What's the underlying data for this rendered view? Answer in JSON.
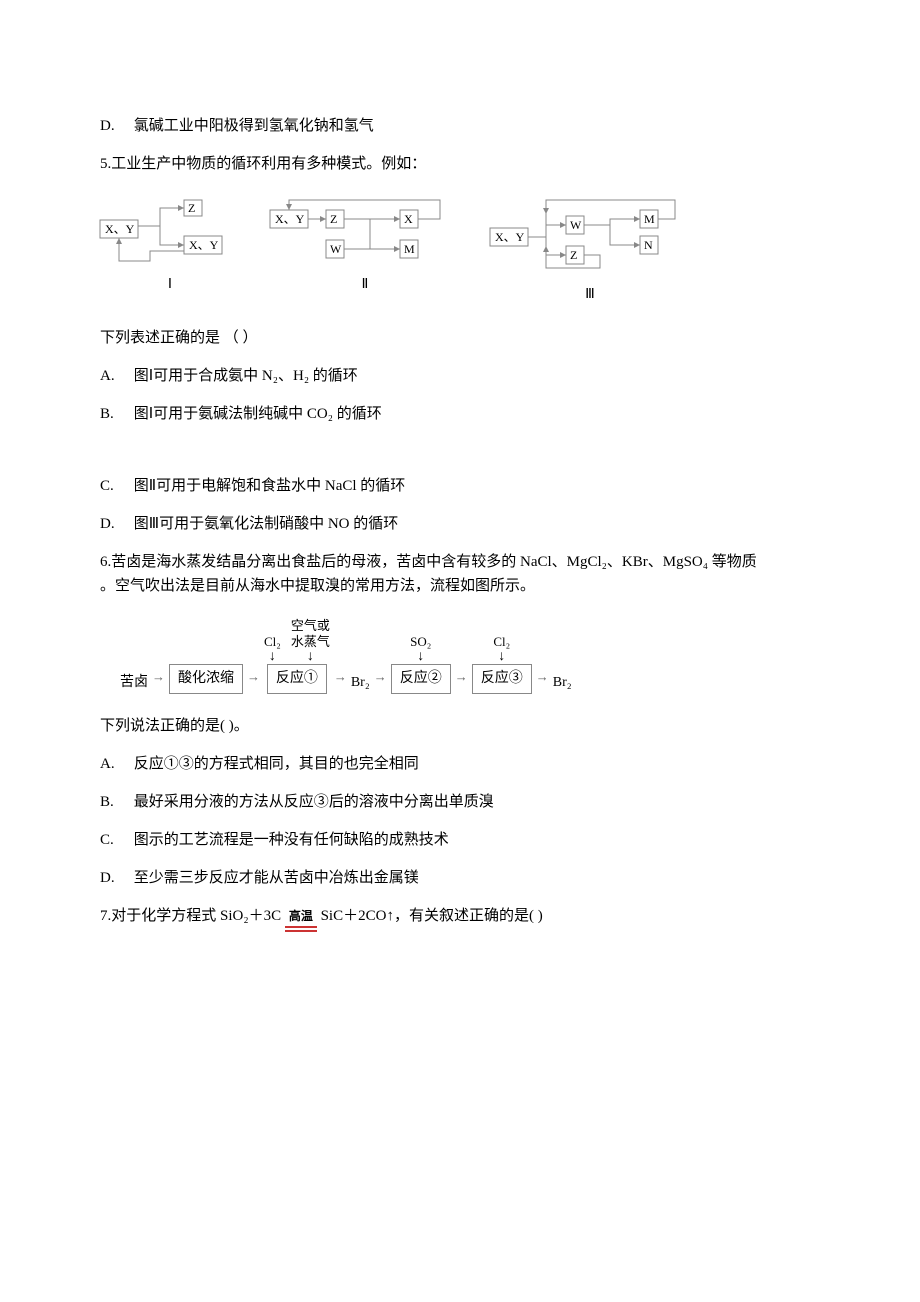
{
  "q4": {
    "d": "氯碱工业中阳极得到氢氧化钠和氢气"
  },
  "q5": {
    "stem": "5.工业生产中物质的循环利用有多种模式。例如：",
    "diagram": {
      "groups": [
        {
          "label": "Ⅰ",
          "boxes": {
            "xy": "X、Y",
            "z": "Z",
            "xy2": "X、Y"
          }
        },
        {
          "label": "Ⅱ",
          "boxes": {
            "xy": "X、Y",
            "z": "Z",
            "w": "W",
            "x": "X",
            "m": "M"
          }
        },
        {
          "label": "Ⅲ",
          "boxes": {
            "xy": "X、Y",
            "w": "W",
            "z": "Z",
            "m": "M",
            "n": "N"
          }
        }
      ]
    },
    "prompt": "下列表述正确的是  （    ）",
    "a": "图Ⅰ可用于合成氨中 N₂、H₂ 的循环",
    "b": "图Ⅰ可用于氨碱法制纯碱中 CO₂ 的循环",
    "c": "图Ⅱ可用于电解饱和食盐水中 NaCl 的循环",
    "d": "图Ⅲ可用于氨氧化法制硝酸中 NO 的循环"
  },
  "q6": {
    "stem_1": "6.苦卤是海水蒸发结晶分离出食盐后的母液，苦卤中含有较多的 NaCl、MgCl₂、KBr、MgSO₄ 等物质",
    "stem_2": "。空气吹出法是目前从海水中提取溴的常用方法，流程如图所示。",
    "flow": {
      "start": "苦卤",
      "step1": "酸化浓缩",
      "in1a": "Cl₂",
      "in1b_1": "空气或",
      "in1b_2": "水蒸气",
      "step2": "反应①",
      "mid1": "Br₂",
      "in2": "SO₂",
      "step3": "反应②",
      "in3": "Cl₂",
      "step4": "反应③",
      "end": "Br₂"
    },
    "prompt": "下列说法正确的是(    )。",
    "a": "反应①③的方程式相同，其目的也完全相同",
    "b": "最好采用分液的方法从反应③后的溶液中分离出单质溴",
    "c": "图示的工艺流程是一种没有任何缺陷的成熟技术",
    "d": "至少需三步反应才能从苦卤中冶炼出金属镁"
  },
  "q7": {
    "stem_pre": "7.对于化学方程式 SiO₂＋3C",
    "condition": "高温",
    "stem_post": "SiC＋2CO↑，有关叙述正确的是(    )"
  },
  "labels": {
    "A": "A.",
    "B": "B.",
    "C": "C.",
    "D": "D."
  }
}
